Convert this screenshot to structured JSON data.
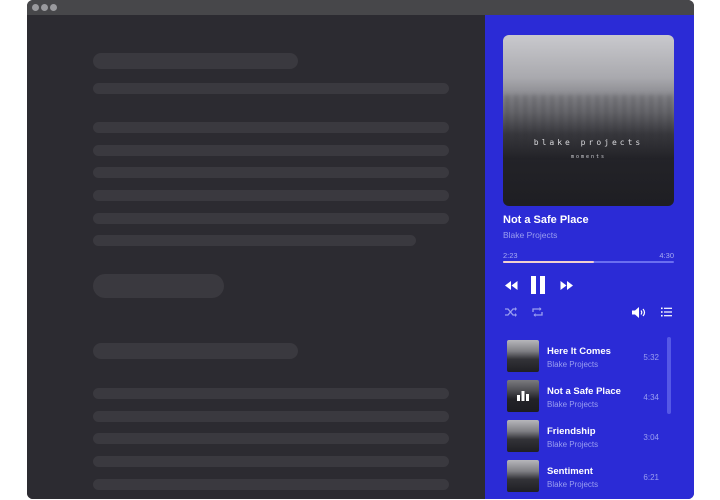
{
  "window": {
    "title_dots": [
      "close",
      "minimize",
      "maximize"
    ]
  },
  "content": {
    "placeholder": "skeleton-text-lines"
  },
  "player": {
    "accent_color": "#2b2bd6",
    "progress_color": "#f1d0cf",
    "cover": {
      "title": "blake projects",
      "subtitle": "moments"
    },
    "now_playing": {
      "title": "Not a Safe Place",
      "artist": "Blake Projects",
      "elapsed": "2:23",
      "total": "4:30",
      "progress_percent": 53
    },
    "controls": {
      "rewind": "rewind-icon",
      "pause": "pause-icon",
      "fast_forward": "fast-forward-icon",
      "shuffle": "shuffle-icon",
      "repeat": "repeat-icon",
      "volume": "volume-icon",
      "queue": "list-icon"
    },
    "playlist": [
      {
        "title": "Here It Comes",
        "artist": "Blake Projects",
        "duration": "5:32",
        "playing": false
      },
      {
        "title": "Not a Safe Place",
        "artist": "Blake Projects",
        "duration": "4:34",
        "playing": true
      },
      {
        "title": "Friendship",
        "artist": "Blake Projects",
        "duration": "3:04",
        "playing": false
      },
      {
        "title": "Sentiment",
        "artist": "Blake Projects",
        "duration": "6:21",
        "playing": false
      }
    ]
  }
}
